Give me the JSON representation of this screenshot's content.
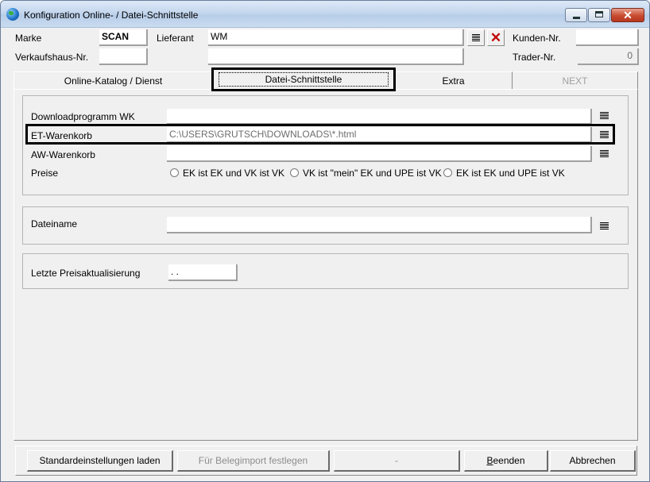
{
  "window": {
    "title": "Konfiguration Online- / Datei-Schnittstelle",
    "minimize_glyph": "",
    "maximize_glyph": "",
    "close_glyph": "✕"
  },
  "header": {
    "marke_label": "Marke",
    "marke_value": "SCAN",
    "lieferant_label": "Lieferant",
    "lieferant_value": "WM",
    "lieferant2_value": "",
    "kunden_label": "Kunden-Nr.",
    "kunden_value": "",
    "verkaufshaus_label": "Verkaufshaus-Nr.",
    "verkaufshaus_value": "",
    "trader_label": "Trader-Nr.",
    "trader_value": "0"
  },
  "tabs": [
    {
      "label": "Online-Katalog / Dienst",
      "state": "normal"
    },
    {
      "label": "Datei-Schnittstelle",
      "state": "selected"
    },
    {
      "label": "Extra",
      "state": "normal"
    },
    {
      "label": "NEXT",
      "state": "disabled"
    }
  ],
  "panel": {
    "downloadprogramm_label": "Downloadprogramm WK",
    "downloadprogramm_value": "",
    "et_label": "ET-Warenkorb",
    "et_value": "C:\\USERS\\GRUTSCH\\DOWNLOADS\\*.html",
    "aw_label": "AW-Warenkorb",
    "aw_value": "",
    "preise_label": "Preise",
    "preise_options": [
      "EK ist EK und VK ist VK",
      "VK ist \"mein\" EK und UPE ist VK",
      "EK ist EK und UPE ist VK"
    ],
    "dateiname_label": "Dateiname",
    "dateiname_value": "",
    "preisaktualisierung_label": "Letzte Preisaktualisierung",
    "preisaktualisierung_value": " .  ."
  },
  "footer": {
    "standard_label": "Standardeinstellungen laden",
    "beleg_label": "Für Belegimport festlegen",
    "dash_label": "-",
    "beenden_label": "Beenden",
    "abbrechen_label": "Abbrechen"
  }
}
